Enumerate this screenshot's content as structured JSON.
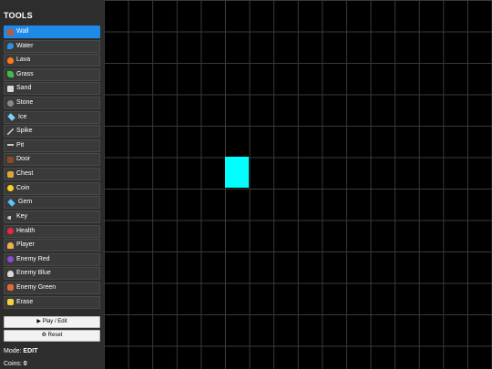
{
  "sidebar": {
    "title": "TOOLS",
    "tools": [
      {
        "label": "Wall",
        "icon": "brick-icon",
        "active": true
      },
      {
        "label": "Water",
        "icon": "wave-icon"
      },
      {
        "label": "Lava",
        "icon": "fire-icon"
      },
      {
        "label": "Grass",
        "icon": "leaf-icon"
      },
      {
        "label": "Sand",
        "icon": "sand-icon"
      },
      {
        "label": "Stone",
        "icon": "rock-icon"
      },
      {
        "label": "Ice",
        "icon": "snowflake-icon"
      },
      {
        "label": "Spike",
        "icon": "spike-icon"
      },
      {
        "label": "Pit",
        "icon": "pit-icon"
      },
      {
        "label": "Door",
        "icon": "door-icon"
      },
      {
        "label": "Chest",
        "icon": "money-bag-icon"
      },
      {
        "label": "Coin",
        "icon": "star-icon"
      },
      {
        "label": "Gem",
        "icon": "gem-icon"
      },
      {
        "label": "Key",
        "icon": "key-icon"
      },
      {
        "label": "Health",
        "icon": "heart-icon"
      },
      {
        "label": "Player",
        "icon": "person-icon"
      },
      {
        "label": "Enemy Red",
        "icon": "alien-monster-icon"
      },
      {
        "label": "Enemy Blue",
        "icon": "alien-icon"
      },
      {
        "label": "Enemy Green",
        "icon": "ogre-icon"
      },
      {
        "label": "Erase",
        "icon": "eraser-icon"
      }
    ],
    "play_label": "▶ Play / Edit",
    "reset_label": "♻ Reset",
    "mode_label": "Mode:",
    "mode_value": "EDIT",
    "coins_label": "Coins:",
    "coins_value": "0"
  },
  "grid": {
    "columns": 16,
    "rows": 12,
    "placed_tiles": [
      {
        "col": 5,
        "row": 5,
        "color": "#00ffff"
      }
    ]
  },
  "colors": {
    "active_tool": "#1e8ae8",
    "sidebar_bg": "#2d2d2d",
    "grid_bg": "#000000",
    "grid_line": "#3a3a3a"
  }
}
